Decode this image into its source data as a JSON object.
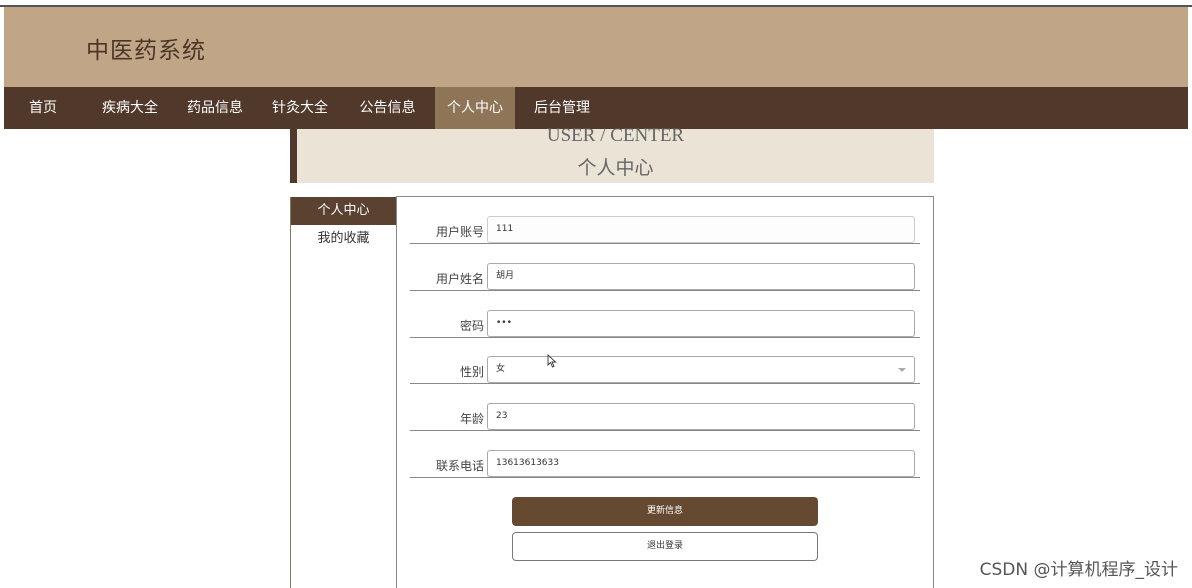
{
  "site": {
    "title": "中医药系统"
  },
  "nav": {
    "items": [
      {
        "label": "首页"
      },
      {
        "label": "疾病大全"
      },
      {
        "label": "药品信息"
      },
      {
        "label": "针灸大全"
      },
      {
        "label": "公告信息"
      },
      {
        "label": "个人中心",
        "active": true
      },
      {
        "label": "后台管理"
      }
    ]
  },
  "banner": {
    "en": "USER / CENTER",
    "cn": "个人中心"
  },
  "sidebar": {
    "items": [
      {
        "label": "个人中心",
        "active": true
      },
      {
        "label": "我的收藏"
      }
    ]
  },
  "form": {
    "fields": [
      {
        "label": "用户账号",
        "value": "111"
      },
      {
        "label": "用户姓名",
        "value": "胡月"
      },
      {
        "label": "密码",
        "value": "•••"
      },
      {
        "label": "性别",
        "value": "女"
      },
      {
        "label": "年龄",
        "value": "23"
      },
      {
        "label": "联系电话",
        "value": "13613613633"
      }
    ],
    "update_label": "更新信息",
    "logout_label": "退出登录"
  },
  "watermark": "CSDN @计算机程序_设计",
  "colors": {
    "header": "#c1a587",
    "nav": "#50382a",
    "accent": "#654a31",
    "banner": "#ebe4d6"
  }
}
